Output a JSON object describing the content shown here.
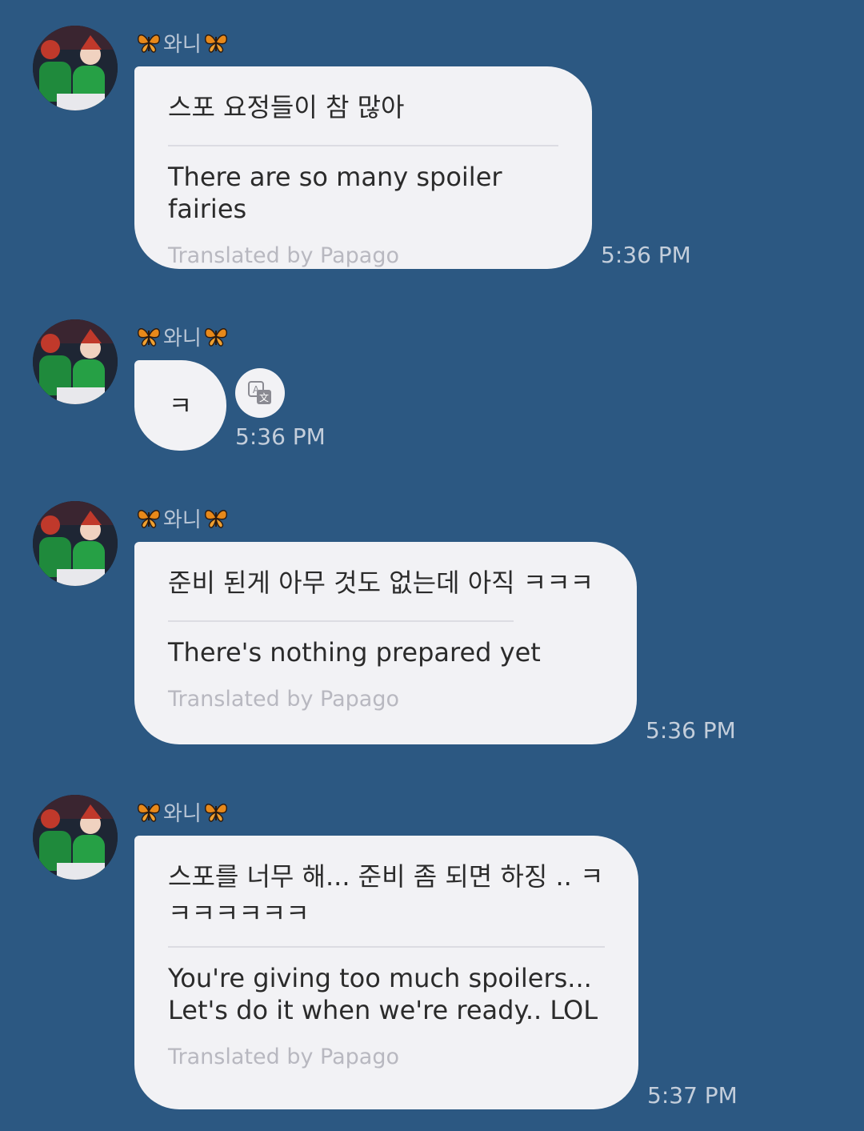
{
  "messages": [
    {
      "sender": "와니",
      "korean": "스포 요정들이 참 많아",
      "english": "There are so many spoiler fairies",
      "translated_by": "Translated by Papago",
      "time": "5:36 PM"
    },
    {
      "sender": "와니",
      "korean": "ㅋ",
      "time": "5:36 PM"
    },
    {
      "sender": "와니",
      "korean": "준비 된게 아무 것도 없는데 아직 ㅋㅋㅋ",
      "english": "There's nothing prepared yet",
      "translated_by": "Translated by Papago",
      "time": "5:36 PM"
    },
    {
      "sender": "와니",
      "korean_line1": "스포를 너무 해... 준비 좀 되면 하징 .. ㅋ",
      "korean_line2": "ㅋㅋㅋㅋㅋㅋ",
      "english_line1": "You're giving too much spoilers...",
      "english_line2": "Let's do it when we're ready.. LOL",
      "translated_by": "Translated by Papago",
      "time": "5:37 PM"
    }
  ],
  "icons": {
    "sender_decoration": "butterfly-icon",
    "translate": "translate-icon"
  },
  "colors": {
    "background": "#2c5882",
    "bubble": "#f2f2f5",
    "meta_text": "#c4cedb"
  }
}
